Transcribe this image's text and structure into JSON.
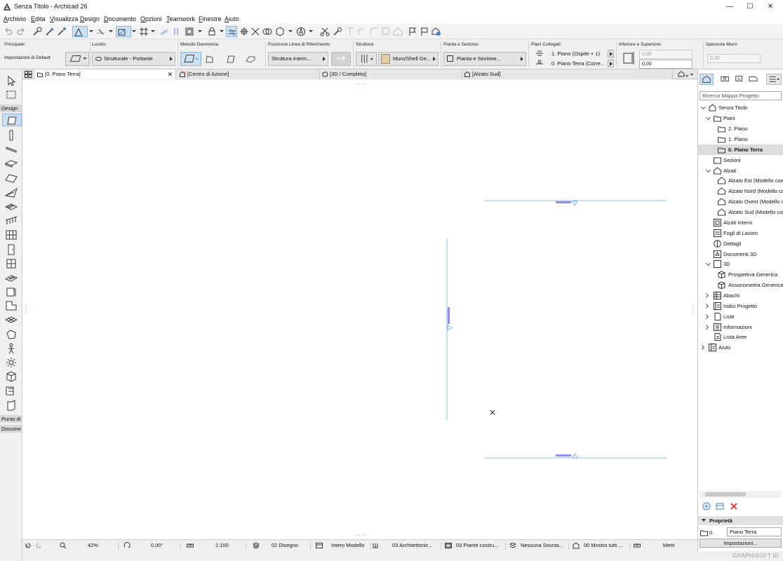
{
  "window": {
    "title": "Senza Titolo - Archicad 26",
    "minimize": "—",
    "maximize": "☐",
    "close": "✕"
  },
  "menu": [
    "Archivio",
    "Edita",
    "Visualizza",
    "Design",
    "Documento",
    "Opzioni",
    "Teamwork",
    "Finestre",
    "Aiuto"
  ],
  "infobox": {
    "principale_label": "Principale:",
    "principale_value": "Impostazioni di Default",
    "lucido_label": "Lucido:",
    "lucido_value": "Strutturale - Portante",
    "metodo_label": "Metodo Geometria:",
    "posizione_label": "Posizione Linea di Riferimento:",
    "posizione_value": "Struttura Intern...",
    "struttura_label": "Struttura:",
    "struttura_value": "Muro/Shell Ge...",
    "pianta_label": "Pianta e Sezione:",
    "pianta_value": "Pianta e Sezione...",
    "piani_label": "Piani Collegati:",
    "piano_top": "1. Piano (Ospite + 1)",
    "piano_bottom": "0. Piano Terra (Corre...",
    "inf_sup_label": "Inferiore e Superiore:",
    "top_value": "3,00",
    "bottom_value": "0,00",
    "spessore_label": "Spessore Muro:",
    "spessore_value": "0,30"
  },
  "tabs": [
    "[0. Piano Terra]",
    "[Centro di Azione]",
    "[3D / Completo]",
    "[Alzato Sud]"
  ],
  "toolbox_sections": [
    "Design",
    "Punto di",
    "Docume"
  ],
  "statusbar": {
    "zoom": "42%",
    "angle": "0,00°",
    "scale": "1:100",
    "pen_set": "02 Disegno",
    "model_view": "Intero Modello",
    "layer_combo": "03 Architettonic...",
    "pens": "03 Piante costru...",
    "overrides": "Nessuna Sovras...",
    "renovation": "00 Mostra tutti ...",
    "units": "Metri"
  },
  "navigator": {
    "search_placeholder": "Ricerca Mappa Progetto",
    "tree": [
      {
        "label": "Senza Titolo",
        "icon": "project-icon"
      },
      {
        "label": "Piani",
        "icon": "folder-icon"
      },
      {
        "label": "2. Piano",
        "icon": "story-icon"
      },
      {
        "label": "1. Piano",
        "icon": "story-icon"
      },
      {
        "label": "0. Piano Terra",
        "icon": "story-icon"
      },
      {
        "label": "Sezioni",
        "icon": "section-icon"
      },
      {
        "label": "Alzati",
        "icon": "elevation-icon"
      },
      {
        "label": "Alzato Est (Modello completo)",
        "icon": "elevation-icon"
      },
      {
        "label": "Alzato Nord (Modello completo)",
        "icon": "elevation-icon"
      },
      {
        "label": "Alzato Ovest (Modello completo)",
        "icon": "elevation-icon"
      },
      {
        "label": "Alzato Sud (Modello completo)",
        "icon": "elevation-icon"
      },
      {
        "label": "Alzati Interni",
        "icon": "interior-elevation-icon"
      },
      {
        "label": "Fogli di Lavoro",
        "icon": "worksheet-icon"
      },
      {
        "label": "Dettagli",
        "icon": "detail-icon"
      },
      {
        "label": "Documenti 3D",
        "icon": "document-3d-icon"
      },
      {
        "label": "3D",
        "icon": "3d-icon"
      },
      {
        "label": "Prospettiva Generica",
        "icon": "perspective-icon"
      },
      {
        "label": "Assonometria Generica",
        "icon": "axonometry-icon"
      },
      {
        "label": "Abachi",
        "icon": "schedule-icon"
      },
      {
        "label": "Indici Progetto",
        "icon": "index-icon"
      },
      {
        "label": "Liste",
        "icon": "list-icon"
      },
      {
        "label": "Informazioni",
        "icon": "info-icon"
      },
      {
        "label": "Lista Aree",
        "icon": "zone-list-icon"
      },
      {
        "label": "Aiuto",
        "icon": "help-icon"
      }
    ],
    "properties_title": "Proprietà",
    "prop_id": "0.",
    "prop_name": "Piano Terra",
    "settings_button": "Impostazioni..."
  },
  "brand": "GRAPHISOFT ID",
  "colors": {
    "accent": "#4a7fcf",
    "selection": "#cce0f4",
    "elevation_line": "#6aa8e8",
    "marker": "#8e8ef0"
  }
}
